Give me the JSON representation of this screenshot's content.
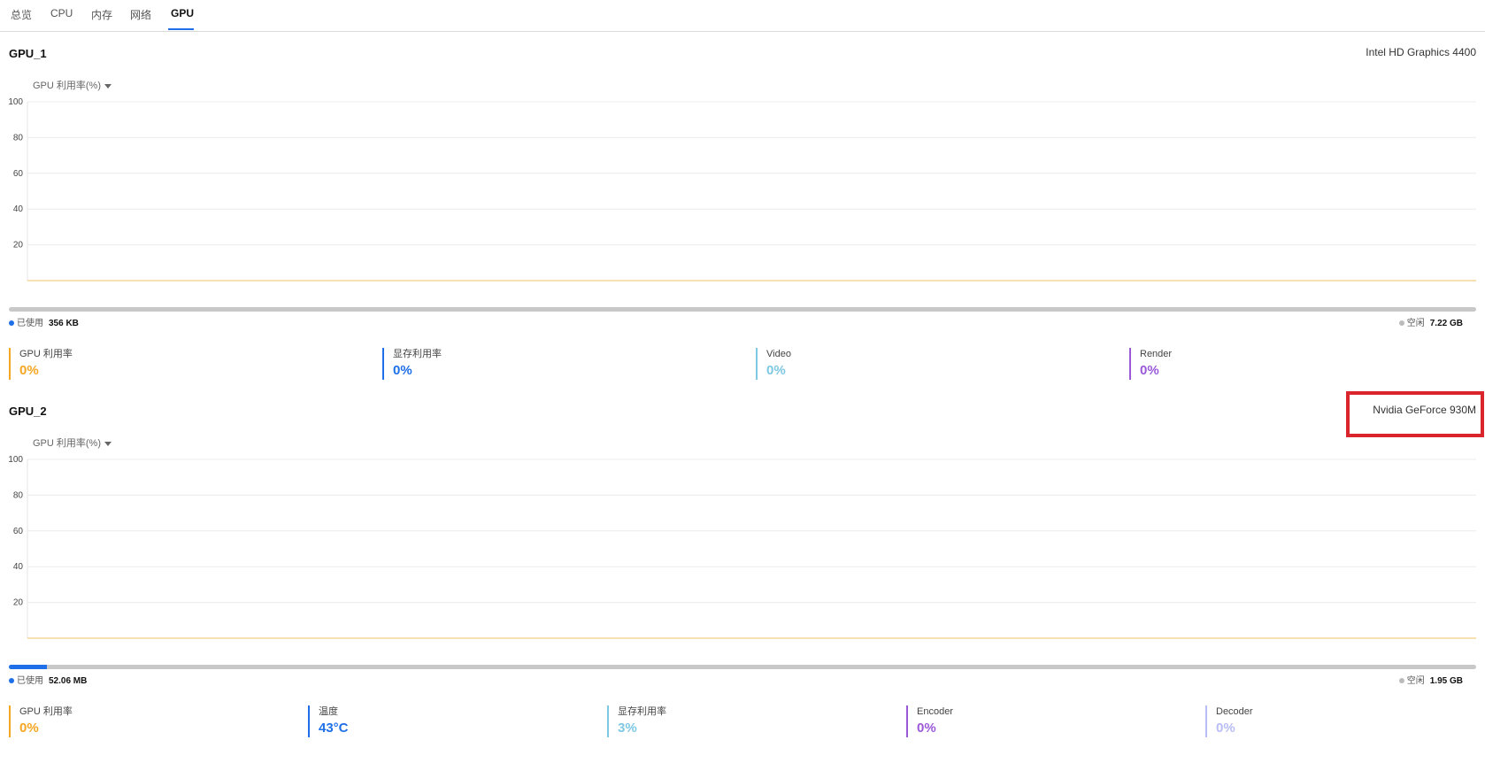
{
  "tabs": [
    "总览",
    "CPU",
    "内存",
    "网络",
    "GPU"
  ],
  "active_tab": "GPU",
  "gpus": [
    {
      "title": "GPU_1",
      "model": "Intel HD Graphics 4400",
      "metric_selector": "GPU 利用率(%)",
      "chart_data": {
        "type": "line",
        "title": "",
        "ylabel": "GPU 利用率(%)",
        "ylim": [
          0,
          100
        ],
        "y_ticks": [
          20,
          40,
          60,
          80,
          100
        ],
        "series": [
          {
            "values": [
              0,
              0
            ],
            "color": "#f0c060"
          }
        ]
      },
      "memory": {
        "used_label": "已使用",
        "used_value": "356 KB",
        "free_label": "空闲",
        "free_value": "7.22 GB",
        "used_fraction": 0.0
      },
      "stats": [
        {
          "label": "GPU 利用率",
          "value": "0%",
          "color": "#f5a623"
        },
        {
          "label": "显存利用率",
          "value": "0%",
          "color": "#1e6fe8"
        },
        {
          "label": "Video",
          "value": "0%",
          "color": "#7ec8e3"
        },
        {
          "label": "Render",
          "value": "0%",
          "color": "#9b59d9"
        }
      ]
    },
    {
      "title": "GPU_2",
      "model": "Nvidia GeForce 930M",
      "metric_selector": "GPU 利用率(%)",
      "chart_data": {
        "type": "line",
        "title": "",
        "ylabel": "GPU 利用率(%)",
        "ylim": [
          0,
          100
        ],
        "y_ticks": [
          20,
          40,
          60,
          80,
          100
        ],
        "series": [
          {
            "values": [
              0,
              0
            ],
            "color": "#f0c060"
          }
        ]
      },
      "memory": {
        "used_label": "已使用",
        "used_value": "52.06 MB",
        "free_label": "空闲",
        "free_value": "1.95 GB",
        "used_fraction": 0.026
      },
      "stats": [
        {
          "label": "GPU 利用率",
          "value": "0%",
          "color": "#f5a623"
        },
        {
          "label": "温度",
          "value": "43°C",
          "color": "#1e6fe8"
        },
        {
          "label": "显存利用率",
          "value": "3%",
          "color": "#7ec8e3"
        },
        {
          "label": "Encoder",
          "value": "0%",
          "color": "#9b59d9"
        },
        {
          "label": "Decoder",
          "value": "0%",
          "color": "#b8bdf5"
        }
      ]
    }
  ],
  "colors": {
    "accent": "#1e6fe8",
    "highlight": "#d9252b",
    "free_dot": "#bbbbbb"
  }
}
